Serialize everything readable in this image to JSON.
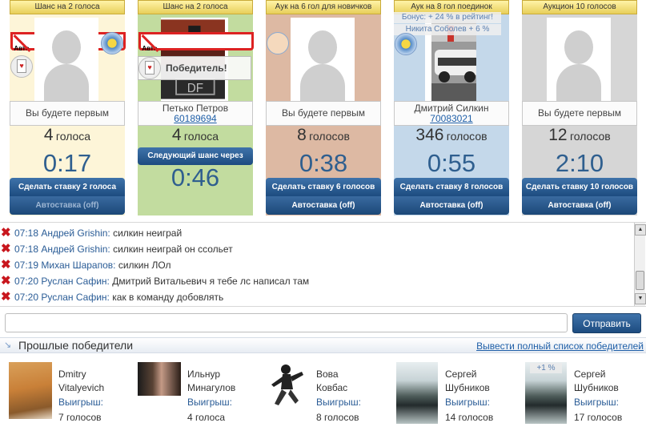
{
  "cards": [
    {
      "header": "Шанс на 2 голоса",
      "badges": [
        "no-auto-icon",
        "playing-card-icon",
        "gear-badge-icon"
      ],
      "player": "Вы будете первым",
      "votes_count": "4",
      "votes_word": "голоса",
      "timer": "0:17",
      "bid_label": "Сделать ставку 2 голоса",
      "autobid_label": "Автоставка (off)",
      "bg": "#fdf5d8"
    },
    {
      "header": "Шанс на 2 голоса",
      "badges": [
        "no-auto-icon",
        "playing-card-icon"
      ],
      "winner_flag": "Победитель!",
      "player_name": "Петько Петров",
      "player_id": "60189694",
      "votes_count": "4",
      "votes_word": "голоса",
      "next_chance": "Следующий шанс через",
      "timer": "0:46",
      "bg": "#c2dc9f"
    },
    {
      "header": "Аук на 6 гол для новичков",
      "badges": [
        "baby-icon"
      ],
      "player": "Вы будете первым",
      "votes_count": "8",
      "votes_word": "голосов",
      "timer": "0:38",
      "bid_label": "Сделать ставку 6 голосов",
      "autobid_label": "Автоставка (off)",
      "bg": "#ddb9a3"
    },
    {
      "header": "Аук на 8 гол поединок",
      "badges": [
        "gear-badge-icon"
      ],
      "bonus1": "Бонус: + 24 % в рейтинг!",
      "bonus2": "Никита Соболев + 6 %",
      "player_name": "Дмитрий Силкин",
      "player_id": "70083021",
      "votes_count": "346",
      "votes_word": "голосов",
      "timer": "0:55",
      "bid_label": "Сделать ставку 8 голосов",
      "autobid_label": "Автоставка (off)",
      "bg": "#c4d8ea"
    },
    {
      "header": "Аукцион 10 голосов",
      "badges": [],
      "player": "Вы будете первым",
      "votes_count": "12",
      "votes_word": "голосов",
      "timer": "2:10",
      "bid_label": "Сделать ставку 10 голосов",
      "autobid_label": "Автоставка (off)",
      "bg": "#d6d6d6"
    }
  ],
  "chat": {
    "messages": [
      {
        "time": "07:18",
        "author": "Андрей Grishin:",
        "text": "силкин неиграй"
      },
      {
        "time": "07:18",
        "author": "Андрей Grishin:",
        "text": "силкин неиграй он ссольет"
      },
      {
        "time": "07:19",
        "author": "Михан Шарапов:",
        "text": "силкин ЛОл"
      },
      {
        "time": "07:20",
        "author": "Руслан Сафин:",
        "text": "Дмитрий Витальевич я тебе лс написал там"
      },
      {
        "time": "07:20",
        "author": "Руслан Сафин:",
        "text": "как в команду добовлять"
      }
    ],
    "input_value": "",
    "send_label": "Отправить"
  },
  "past_winners": {
    "title": "Прошлые победители",
    "all_link": "Вывести полный список победителей",
    "win_label": "Выигрыш:",
    "items": [
      {
        "first": "Dmitry",
        "last": "Vitalyevich",
        "prize": "7 голосов"
      },
      {
        "first": "Ильнур",
        "last": "Минагулов",
        "prize": "4 голоса"
      },
      {
        "first": "Вова",
        "last": "Ковбас",
        "prize": "8 голосов"
      },
      {
        "first": "Сергей",
        "last": "Шубников",
        "prize": "14 голосов"
      },
      {
        "first": "Сергей",
        "last": "Шубников",
        "prize": "17 голосов",
        "badge": "+1 %"
      }
    ]
  }
}
